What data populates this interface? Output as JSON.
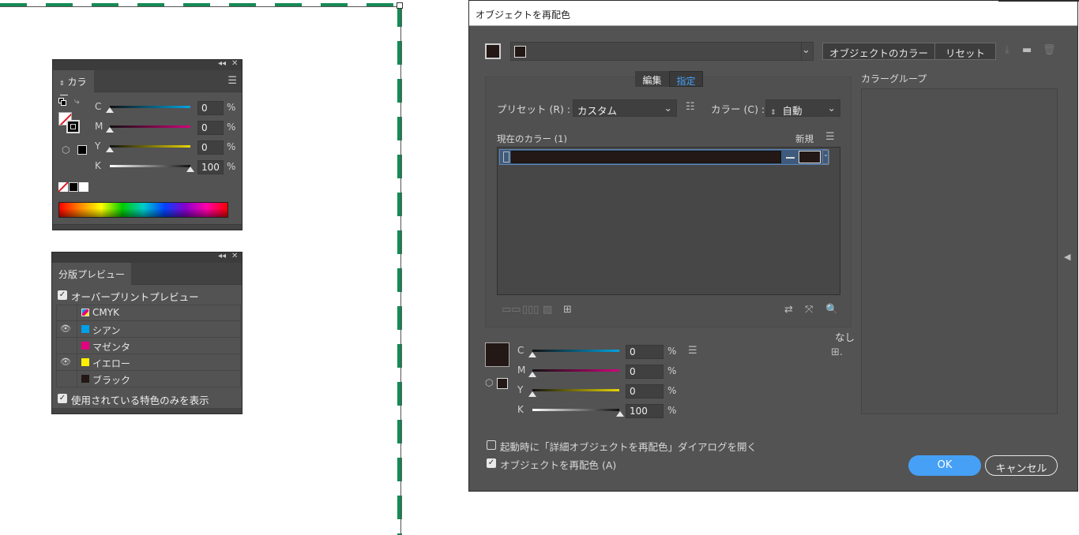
{
  "color_panel": {
    "collapse_icon": "double-chevron-left",
    "close_icon": "close",
    "tab_label": "カラー",
    "menu_icon": "hamburger",
    "sliders": [
      {
        "label": "C",
        "value": "0",
        "unit": "%",
        "track_color": "#00a3e0"
      },
      {
        "label": "M",
        "value": "0",
        "unit": "%",
        "track_color": "#d1007a"
      },
      {
        "label": "Y",
        "value": "0",
        "unit": "%",
        "track_color": "#e7d600"
      },
      {
        "label": "K",
        "value": "100",
        "unit": "%",
        "track_color": "#000000"
      }
    ]
  },
  "separations_panel": {
    "tab_label": "分版プレビュー",
    "overprint_label": "オーバープリントプレビュー",
    "overprint_checked": true,
    "rows": [
      {
        "name": "CMYK",
        "swatch": "cmyk",
        "visible": false
      },
      {
        "name": "シアン",
        "swatch": "#00a0e9",
        "visible": true
      },
      {
        "name": "マゼンタ",
        "swatch": "#e4007f",
        "visible": false
      },
      {
        "name": "イエロー",
        "swatch": "#fff100",
        "visible": true
      },
      {
        "name": "ブラック",
        "swatch": "#231815",
        "visible": false
      }
    ],
    "spot_only_label": "使用されている特色のみを表示",
    "spot_only_checked": true
  },
  "dialog": {
    "title": "オブジェクトを再配色",
    "object_colors_button": "オブジェクトのカラー",
    "reset_button": "リセット",
    "tabs": {
      "edit": "編集",
      "assign": "指定"
    },
    "active_tab": "assign",
    "preset_label": "プリセット (R) :",
    "preset_value": "カスタム",
    "colors_label": "カラー (C) :",
    "colors_value": "自動",
    "current_colors_label": "現在のカラー (1)",
    "new_label": "新規",
    "color_group_label": "カラーグループ",
    "none_label": "なし",
    "sliders": [
      {
        "label": "C",
        "value": "0",
        "unit": "%",
        "track_color": "#00a3e0"
      },
      {
        "label": "M",
        "value": "0",
        "unit": "%",
        "track_color": "#d1007a"
      },
      {
        "label": "Y",
        "value": "0",
        "unit": "%",
        "track_color": "#e7d600"
      },
      {
        "label": "K",
        "value": "100",
        "unit": "%",
        "track_color": "#000000"
      }
    ],
    "open_advanced_label": "起動時に「詳細オブジェクトを再配色」ダイアログを開く",
    "open_advanced_checked": false,
    "recolor_label": "オブジェクトを再配色 (A)",
    "recolor_checked": true,
    "ok_button": "OK",
    "cancel_button": "キャンセル",
    "accent_color": "#46a0f5",
    "current_color_swatch": "#231815"
  }
}
